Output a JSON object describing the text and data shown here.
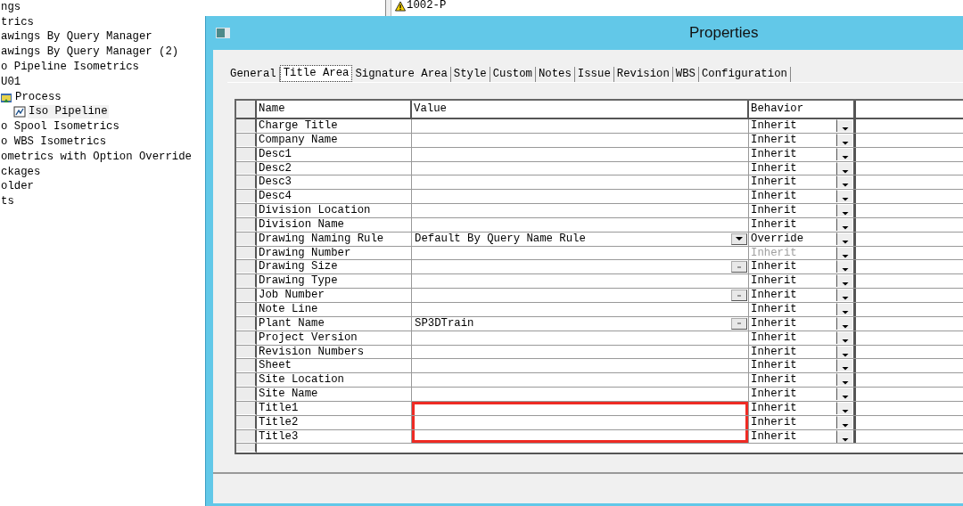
{
  "tree": [
    {
      "label": "ngs",
      "selected": false
    },
    {
      "label": "trics",
      "selected": false
    },
    {
      "label": "awings By Query Manager",
      "selected": false
    },
    {
      "label": "awings By Query Manager (2)",
      "selected": false
    },
    {
      "label": "o Pipeline Isometrics",
      "selected": false
    },
    {
      "label": "U01",
      "selected": false,
      "children": [
        {
          "label": "Process",
          "selected": false,
          "children": [
            {
              "label": "Iso Pipeline",
              "selected": true
            }
          ]
        }
      ]
    },
    {
      "label": "o Spool Isometrics",
      "selected": false
    },
    {
      "label": "o WBS Isometrics",
      "selected": false
    },
    {
      "label": "ometrics with Option Override",
      "selected": false
    },
    {
      "label": "ckages",
      "selected": false
    },
    {
      "label": "older",
      "selected": false
    },
    {
      "label": "ts",
      "selected": false
    }
  ],
  "list": [
    {
      "label": "1002-P",
      "kind": "warning"
    }
  ],
  "window": {
    "title": "Properties"
  },
  "tabs": [
    {
      "label": "General",
      "selected": false
    },
    {
      "label": "Title Area",
      "selected": true
    },
    {
      "label": "Signature Area",
      "selected": false
    },
    {
      "label": "Style",
      "selected": false
    },
    {
      "label": "Custom",
      "selected": false
    },
    {
      "label": "Notes",
      "selected": false
    },
    {
      "label": "Issue",
      "selected": false
    },
    {
      "label": "Revision",
      "selected": false
    },
    {
      "label": "WBS",
      "selected": false
    },
    {
      "label": "Configuration",
      "selected": false
    }
  ],
  "table": {
    "columns": [
      "Name",
      "Value",
      "Behavior"
    ],
    "rows": [
      {
        "name": "Charge Title",
        "kind": "plain",
        "behavior": "Inherit",
        "disabled": false,
        "highlighted": false
      },
      {
        "name": "Company Name",
        "kind": "plain",
        "behavior": "Inherit",
        "disabled": false,
        "highlighted": false
      },
      {
        "name": "Desc1",
        "kind": "plain",
        "behavior": "Inherit",
        "disabled": false,
        "highlighted": false
      },
      {
        "name": "Desc2",
        "kind": "plain",
        "behavior": "Inherit",
        "disabled": false,
        "highlighted": false
      },
      {
        "name": "Desc3",
        "kind": "plain",
        "behavior": "Inherit",
        "disabled": false,
        "highlighted": false
      },
      {
        "name": "Desc4",
        "kind": "plain",
        "behavior": "Inherit",
        "disabled": false,
        "highlighted": false
      },
      {
        "name": "Division Location",
        "kind": "plain",
        "behavior": "Inherit",
        "disabled": false,
        "highlighted": false
      },
      {
        "name": "Division Name",
        "kind": "plain",
        "behavior": "Inherit",
        "disabled": false,
        "highlighted": false
      },
      {
        "name": "Drawing Naming Rule",
        "value": "Default By Query Name Rule",
        "kind": "dropdown",
        "behavior": "Override",
        "disabled": false,
        "highlighted": false
      },
      {
        "name": "Drawing Number",
        "kind": "plain",
        "behavior": "Inherit",
        "disabled": true,
        "highlighted": false
      },
      {
        "name": "Drawing Size",
        "kind": "ellipsis",
        "behavior": "Inherit",
        "disabled": false,
        "highlighted": false
      },
      {
        "name": "Drawing Type",
        "kind": "plain",
        "behavior": "Inherit",
        "disabled": false,
        "highlighted": false
      },
      {
        "name": "Job Number",
        "kind": "ellipsis",
        "behavior": "Inherit",
        "disabled": false,
        "highlighted": false
      },
      {
        "name": "Note Line",
        "kind": "plain",
        "behavior": "Inherit",
        "disabled": false,
        "highlighted": false
      },
      {
        "name": "Plant Name",
        "value": "SP3DTrain",
        "kind": "ellipsis",
        "behavior": "Inherit",
        "disabled": false,
        "highlighted": false
      },
      {
        "name": "Project Version",
        "kind": "plain",
        "behavior": "Inherit",
        "disabled": false,
        "highlighted": false
      },
      {
        "name": "Revision Numbers",
        "kind": "plain",
        "behavior": "Inherit",
        "disabled": false,
        "highlighted": false
      },
      {
        "name": "Sheet",
        "kind": "plain",
        "behavior": "Inherit",
        "disabled": false,
        "highlighted": false
      },
      {
        "name": "Site Location",
        "kind": "plain",
        "behavior": "Inherit",
        "disabled": false,
        "highlighted": false
      },
      {
        "name": "Site Name",
        "kind": "plain",
        "behavior": "Inherit",
        "disabled": false,
        "highlighted": false
      },
      {
        "name": "Title1",
        "kind": "plain",
        "behavior": "Inherit",
        "disabled": false,
        "highlighted": true
      },
      {
        "name": "Title2",
        "kind": "plain",
        "behavior": "Inherit",
        "disabled": false,
        "highlighted": true
      },
      {
        "name": "Title3",
        "kind": "plain",
        "behavior": "Inherit",
        "disabled": false,
        "highlighted": true
      }
    ]
  }
}
